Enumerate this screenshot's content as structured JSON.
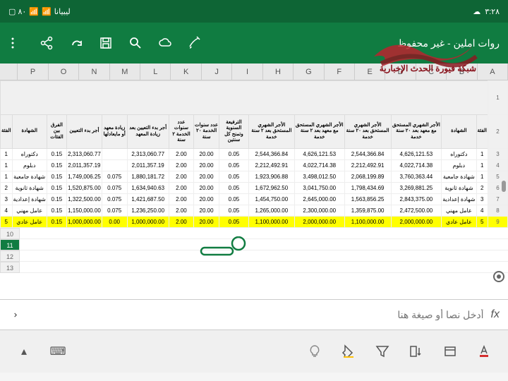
{
  "status": {
    "time": "٣:٢٨",
    "battery": "٨٠",
    "carrier": "ليبيانا"
  },
  "header": {
    "title": "روات  املين - غير محفوظ"
  },
  "cols": [
    "P",
    "O",
    "N",
    "M",
    "L",
    "K",
    "J",
    "I",
    "H",
    "G",
    "F",
    "E",
    "D",
    "C",
    "B",
    "A"
  ],
  "table": {
    "headers": [
      "الفئة",
      "الشهادة",
      "الأجر الشهري المستحق مع معهد بعد ٢٠ سنة خدمة",
      "الأجر الشهري المستحق بعد ٢٠ سنة خدمة",
      "الأجر الشهري المستحق مع معهد بعد ٢ سنة خدمة",
      "الأجر الشهري المستحق بعد ٢ سنة خدمة",
      "الترفيعة السنوية وتمنح كل سنتين",
      "عدد سنوات الخدمة ٢٠ سنة",
      "عدد سنوات الخدمة ٢ سنة",
      "أجر بدء التعيين بعد زيادة المعهد",
      "زيادة معهد أو مايعادلها",
      "أجر بدء التعيين",
      "الفرق بين الفئات",
      "الشهادة",
      "الفئة"
    ],
    "rows": [
      {
        "n": "3",
        "c": [
          "1",
          "دكتوراه",
          "4,626,121.53",
          "2,544,366.84",
          "4,626,121.53",
          "2,544,366.84",
          "0.05",
          "20.00",
          "2.00",
          "2,313,060.77",
          "",
          "2,313,060.77",
          "0.15",
          "دكتوراه",
          "1"
        ]
      },
      {
        "n": "4",
        "c": [
          "1",
          "دبلوم",
          "4,022,714.38",
          "2,212,492.91",
          "4,022,714.38",
          "2,212,492.91",
          "0.05",
          "20.00",
          "2.00",
          "2,011,357.19",
          "",
          "2,011,357.19",
          "0.15",
          "دبلوم",
          "1"
        ]
      },
      {
        "n": "5",
        "c": [
          "1",
          "شهادة جامعية",
          "3,760,363.44",
          "2,068,199.89",
          "3,498,012.50",
          "1,923,906.88",
          "0.05",
          "20.00",
          "2.00",
          "1,880,181.72",
          "0.075",
          "1,749,006.25",
          "0.15",
          "شهادة جامعية",
          "1"
        ]
      },
      {
        "n": "6",
        "c": [
          "2",
          "شهادة ثانوية",
          "3,269,881.25",
          "1,798,434.69",
          "3,041,750.00",
          "1,672,962.50",
          "0.05",
          "20.00",
          "2.00",
          "1,634,940.63",
          "0.075",
          "1,520,875.00",
          "0.15",
          "شهادة ثانوية",
          "2"
        ]
      },
      {
        "n": "7",
        "c": [
          "3",
          "شهادة إعدادية",
          "2,843,375.00",
          "1,563,856.25",
          "2,645,000.00",
          "1,454,750.00",
          "0.05",
          "20.00",
          "2.00",
          "1,421,687.50",
          "0.075",
          "1,322,500.00",
          "0.15",
          "شهادة إعدادية",
          "3"
        ]
      },
      {
        "n": "8",
        "c": [
          "4",
          "عامل مهني",
          "2,472,500.00",
          "1,359,875.00",
          "2,300,000.00",
          "1,265,000.00",
          "0.05",
          "20.00",
          "2.00",
          "1,236,250.00",
          "0.075",
          "1,150,000.00",
          "0.15",
          "عامل مهني",
          "4"
        ]
      },
      {
        "n": "9",
        "c": [
          "5",
          "عامل عادي",
          "2,000,000.00",
          "1,100,000.00",
          "2,000,000.00",
          "1,100,000.00",
          "0.05",
          "20.00",
          "2.00",
          "1,000,000.00",
          "0.00",
          "1,000,000.00",
          "0.15",
          "عامل عادي",
          "5"
        ],
        "hl": true
      }
    ],
    "emptyRows": [
      "10",
      "11",
      "12",
      "13"
    ],
    "selectedRow": "11"
  },
  "formula": {
    "placeholder": "أدخل نصا أو صيغة هنا",
    "fx": "fx"
  },
  "watermark_text": "شبكة فيورة الحدث الإخبارية"
}
